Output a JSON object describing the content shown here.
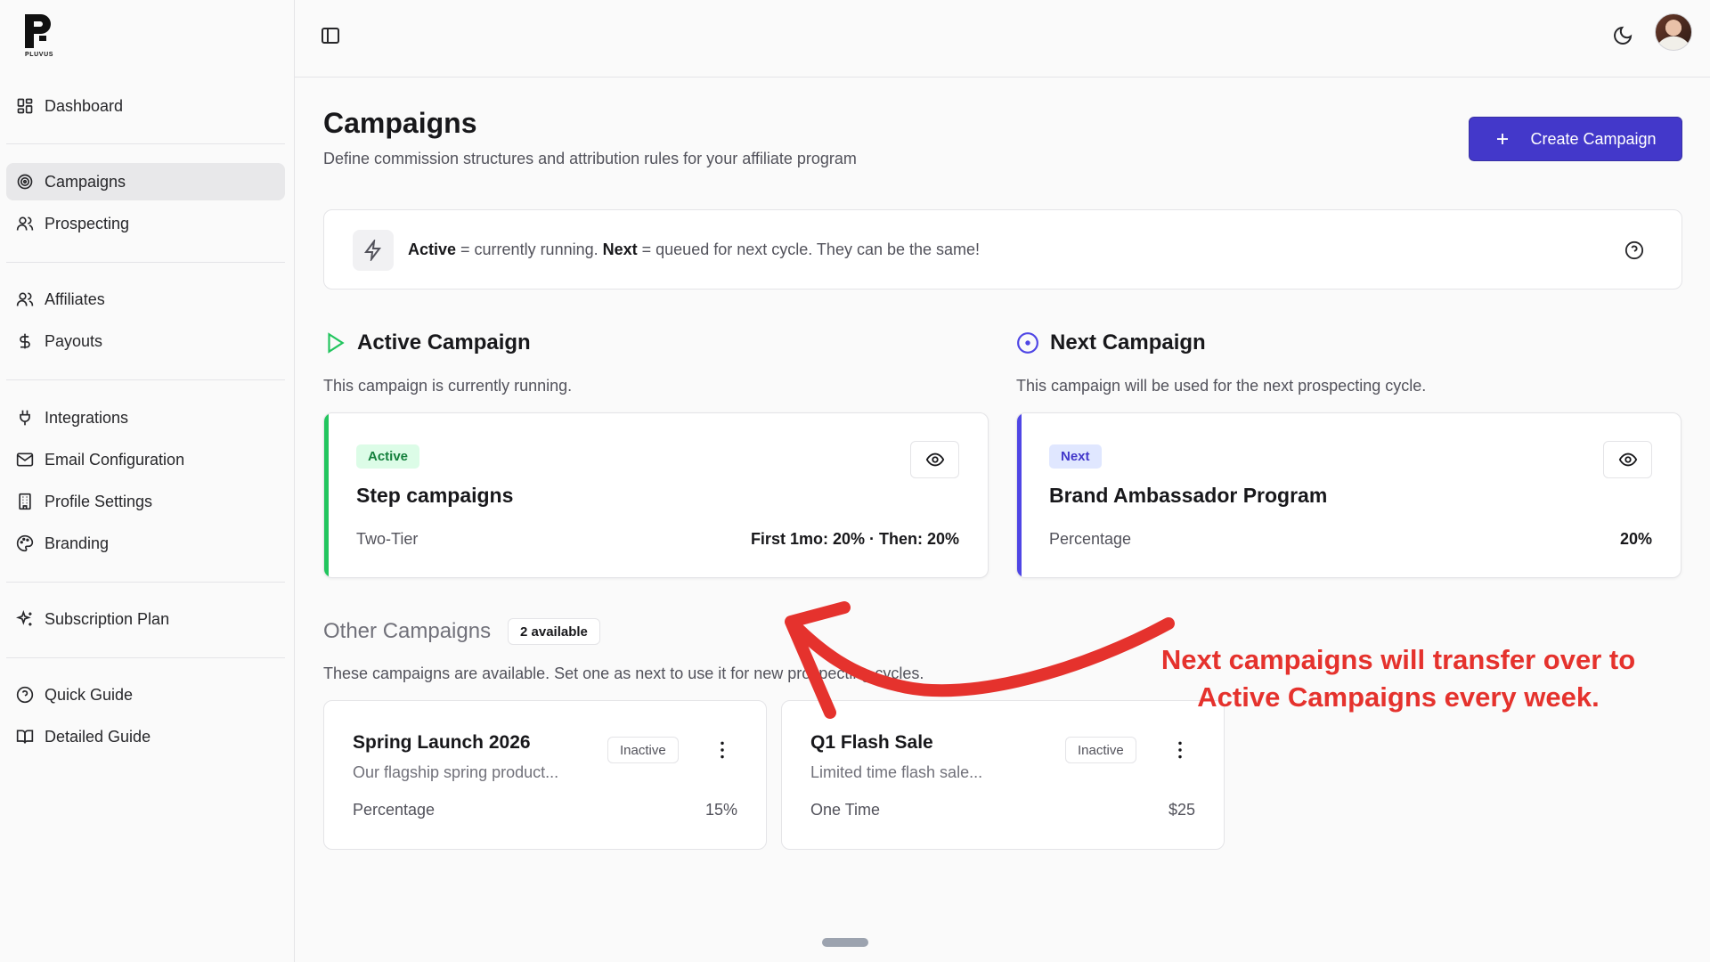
{
  "brand": {
    "name": "PLUVUS"
  },
  "sidebar": {
    "items": [
      {
        "label": "Dashboard",
        "icon": "grid-icon"
      },
      {
        "label": "Campaigns",
        "icon": "target-icon",
        "active": true
      },
      {
        "label": "Prospecting",
        "icon": "users-icon"
      },
      {
        "label": "Affiliates",
        "icon": "users-icon"
      },
      {
        "label": "Payouts",
        "icon": "dollar-icon"
      },
      {
        "label": "Integrations",
        "icon": "plug-icon"
      },
      {
        "label": "Email Configuration",
        "icon": "mail-icon"
      },
      {
        "label": "Profile Settings",
        "icon": "building-icon"
      },
      {
        "label": "Branding",
        "icon": "palette-icon"
      },
      {
        "label": "Subscription Plan",
        "icon": "sparkles-icon"
      },
      {
        "label": "Quick Guide",
        "icon": "help-circle-icon"
      },
      {
        "label": "Detailed Guide",
        "icon": "book-icon"
      }
    ]
  },
  "header": {
    "title": "Campaigns",
    "subtitle": "Define commission structures and attribution rules for your affiliate program",
    "create_label": "Create Campaign"
  },
  "info": {
    "active_term": "Active",
    "active_desc": " = currently running. ",
    "next_term": "Next",
    "next_desc": " = queued for next cycle. They can be the same!"
  },
  "active_section": {
    "title": "Active Campaign",
    "desc": "This campaign is currently running.",
    "card": {
      "badge": "Active",
      "name": "Step campaigns",
      "type": "Two-Tier",
      "rate": "First 1mo: 20% · Then: 20%"
    }
  },
  "next_section": {
    "title": "Next Campaign",
    "desc": "This campaign will be used for the next prospecting cycle.",
    "card": {
      "badge": "Next",
      "name": "Brand Ambassador Program",
      "type": "Percentage",
      "rate": "20%"
    }
  },
  "other_section": {
    "title": "Other Campaigns",
    "count": "2 available",
    "desc": "These campaigns are available. Set one as next to use it for new prospecting cycles.",
    "cards": [
      {
        "name": "Spring Launch 2026",
        "desc": "Our flagship spring product...",
        "status": "Inactive",
        "type": "Percentage",
        "rate": "15%"
      },
      {
        "name": "Q1 Flash Sale",
        "desc": "Limited time flash sale...",
        "status": "Inactive",
        "type": "One Time",
        "rate": "$25"
      }
    ]
  },
  "annotation": {
    "line1": "Next campaigns will transfer over to",
    "line2": "Active Campaigns every week.",
    "color": "#e5322d"
  },
  "colors": {
    "primary": "#4338ca",
    "active_green": "#22c55e",
    "next_indigo": "#4f46e5"
  }
}
